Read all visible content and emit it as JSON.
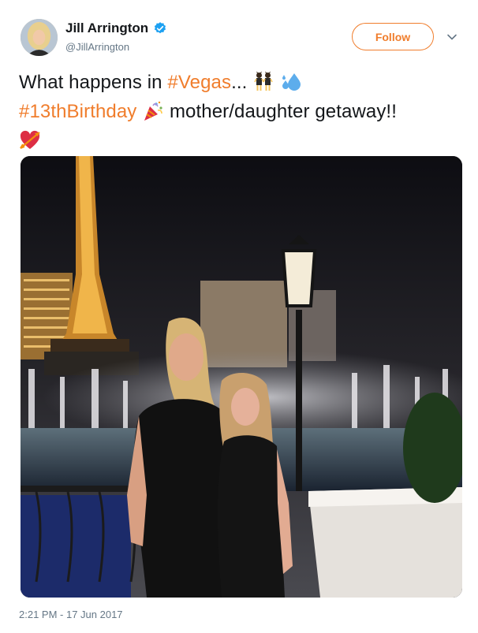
{
  "author": {
    "display_name": "Jill Arrington",
    "handle": "@JillArrington",
    "verified": true,
    "avatar_icon": "profile-photo"
  },
  "actions": {
    "follow_label": "Follow",
    "menu_icon": "chevron-down-icon"
  },
  "tweet": {
    "line1_text": "What happens in ",
    "hashtag_vegas": "#Vegas",
    "line1_suffix": "...",
    "hashtag_birthday": "#13thBirthday",
    "line2_suffix": " mother/daughter getaway!!",
    "emojis": [
      "dancers-emoji",
      "sweat-droplets-emoji",
      "party-popper-emoji",
      "heart-with-arrow-emoji"
    ]
  },
  "media": {
    "image_icon": "vegas-photo"
  },
  "timestamp": "2:21 PM - 17 Jun 2017",
  "colors": {
    "accent": "#f07d2c",
    "verified_blue": "#1da1f2",
    "secondary_text": "#657786"
  }
}
